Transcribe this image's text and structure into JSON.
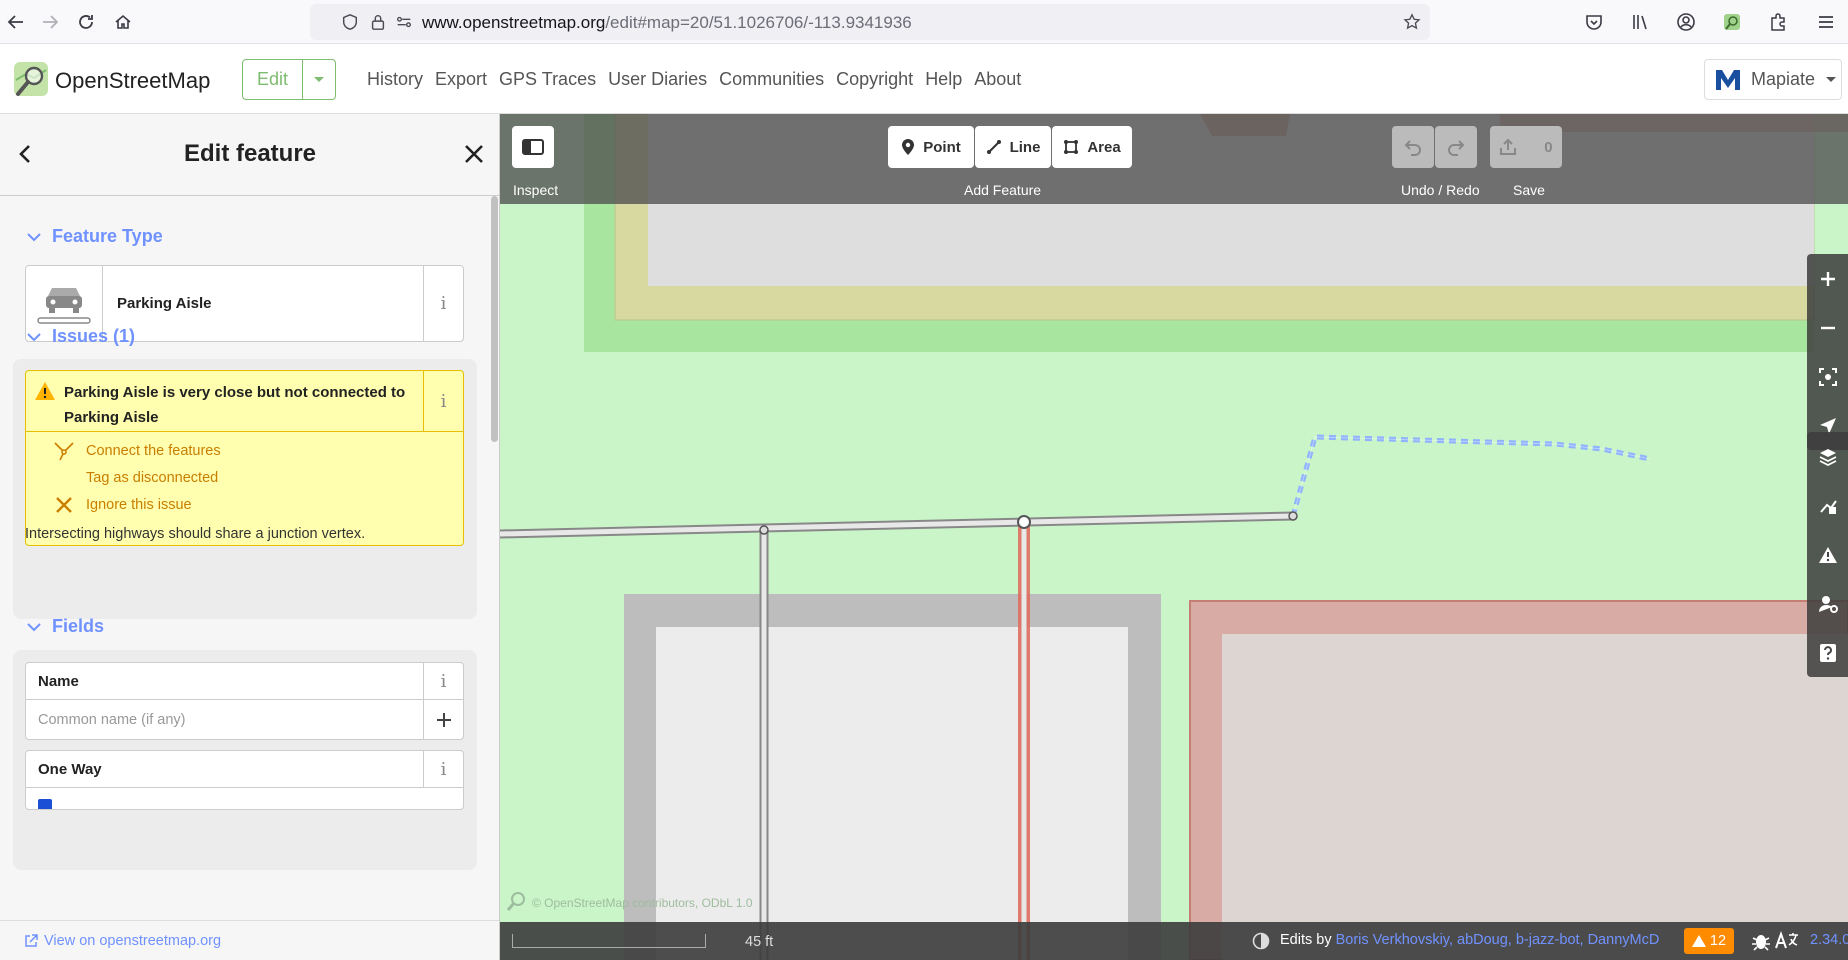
{
  "browser": {
    "url_host": "www.openstreetmap.org",
    "url_rest": "/edit#map=20/51.1026706/-113.9341936"
  },
  "header": {
    "brand": "OpenStreetMap",
    "edit_label": "Edit",
    "nav": [
      "History",
      "Export",
      "GPS Traces",
      "User Diaries",
      "Communities",
      "Copyright",
      "Help",
      "About"
    ],
    "user": "Mapiate"
  },
  "sidebar": {
    "title": "Edit feature",
    "feature_type_heading": "Feature Type",
    "feature_type": "Parking Aisle",
    "issues_heading": "Issues (1)",
    "issue_message": "Parking Aisle is very close but not connected to Parking Aisle",
    "fixes": [
      "Connect the features",
      "Tag as disconnected",
      "Ignore this issue"
    ],
    "issue_tip": "Intersecting highways should share a junction vertex.",
    "fields_heading": "Fields",
    "fields": [
      {
        "label": "Name",
        "placeholder": "Common name (if any)"
      },
      {
        "label": "One Way"
      }
    ],
    "view_link": "View on openstreetmap.org"
  },
  "map": {
    "inspect_label": "Inspect",
    "add_point": "Point",
    "add_line": "Line",
    "add_area": "Area",
    "add_feature_label": "Add Feature",
    "undo_redo_label": "Undo / Redo",
    "save_count": "0",
    "save_label": "Save",
    "attribution": "© OpenStreetMap contributors, ODbL 1.0",
    "scale_label": "45 ft",
    "edits_by_prefix": "Edits by ",
    "edits_by_people": "Boris Verkhovskiy, abDoug, b-jazz-bot, DannyMcD",
    "issue_count": "12",
    "version": "2.34.0"
  },
  "colors": {
    "accent": "#7092ff",
    "osm_green": "#7ebc6f",
    "warning": "#ff8c00",
    "landuse_green": "#c9f5c9",
    "selected_way": "#e06e5f"
  }
}
